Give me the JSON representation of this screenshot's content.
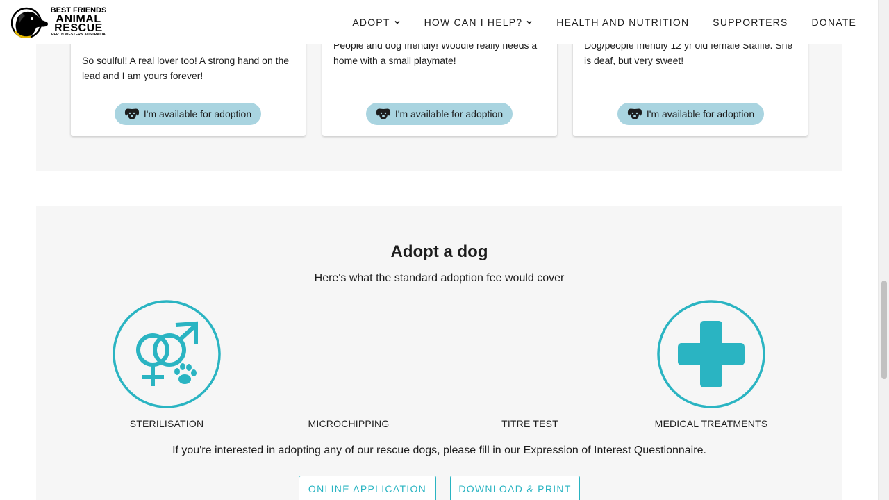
{
  "header": {
    "logo": {
      "line1": "BEST FRIENDS",
      "line2": "ANIMAL",
      "line3": "RESCUE",
      "line4": "PERTH WESTERN AUSTRALIA"
    },
    "nav": [
      {
        "label": "ADOPT",
        "has_dropdown": true
      },
      {
        "label": "HOW CAN I HELP?",
        "has_dropdown": true
      },
      {
        "label": "HEALTH AND NUTRITION",
        "has_dropdown": false
      },
      {
        "label": "SUPPORTERS",
        "has_dropdown": false
      },
      {
        "label": "DONATE",
        "has_dropdown": false
      }
    ]
  },
  "cards": [
    {
      "line1": "So soulful! A real lover too! A strong hand on the",
      "line2": "lead and I am yours forever!",
      "button_label": "I'm available for adoption"
    },
    {
      "line1": "People and dog friendly! Woodie really needs a",
      "line2": "home with a small playmate!",
      "button_label": "I'm available for adoption"
    },
    {
      "line1": "Dog/people friendly 12 yr old female Staffie. She",
      "line2": "is deaf, but very sweet!",
      "button_label": "I'm available for adoption"
    }
  ],
  "adopt": {
    "title": "Adopt a dog",
    "subtitle": "Here's what the standard adoption fee would cover",
    "features": [
      {
        "label": "STERILISATION",
        "icon": "sterilisation-icon"
      },
      {
        "label": "MICROCHIPPING",
        "icon": ""
      },
      {
        "label": "TITRE TEST",
        "icon": ""
      },
      {
        "label": "MEDICAL TREATMENTS",
        "icon": "medical-cross-icon"
      }
    ],
    "interest_text": "If you're interested in adopting any of our rescue dogs, please fill in our Expression of Interest Questionnaire.",
    "buttons": {
      "online": "ONLINE APPLICATION",
      "download": "DOWNLOAD & PRINT"
    }
  },
  "colors": {
    "accent": "#2ab4c2",
    "pill": "#a9d4e0",
    "section_bg": "#f6f6f6"
  }
}
